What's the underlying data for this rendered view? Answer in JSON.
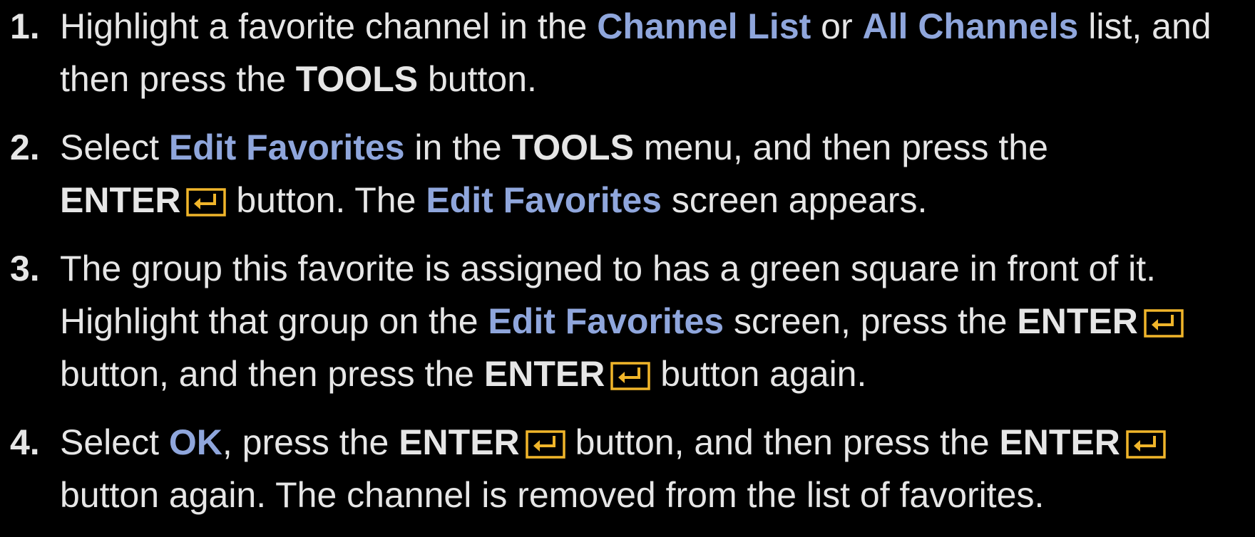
{
  "colors": {
    "background": "#000000",
    "text": "#e6e6e6",
    "highlight": "#8fa6dc",
    "enter_icon": "#f0b52a"
  },
  "icons": {
    "enter": "enter-icon"
  },
  "steps": [
    {
      "num": "1.",
      "l1_a": "Highlight a favorite channel in the ",
      "l1_b": "Channel List",
      "l1_c": " or ",
      "l1_d": "All Channels",
      "l1_e": " list, and",
      "l2_a": "then press the ",
      "l2_b": "TOOLS",
      "l2_c": " button."
    },
    {
      "num": "2.",
      "l1_a": "Select ",
      "l1_b": "Edit Favorites",
      "l1_c": " in the ",
      "l1_d": "TOOLS",
      "l1_e": " menu, and then press the",
      "l2_a": "ENTER",
      "l2_b": " button. The ",
      "l2_c": "Edit Favorites",
      "l2_d": " screen appears."
    },
    {
      "num": "3.",
      "l1_a": "The group this favorite is assigned to has a green square in front of it.",
      "l2_a": "Highlight that group on the ",
      "l2_b": "Edit Favorites",
      "l2_c": " screen, press the ",
      "l2_d": "ENTER",
      "l3_a": "button, and then press the ",
      "l3_b": "ENTER",
      "l3_c": " button again."
    },
    {
      "num": "4.",
      "l1_a": "Select ",
      "l1_b": "OK",
      "l1_c": ", press the ",
      "l1_d": "ENTER",
      "l1_e": " button, and then press the ",
      "l1_f": "ENTER",
      "l2_a": "button again. The channel is removed from the list of favorites."
    }
  ]
}
